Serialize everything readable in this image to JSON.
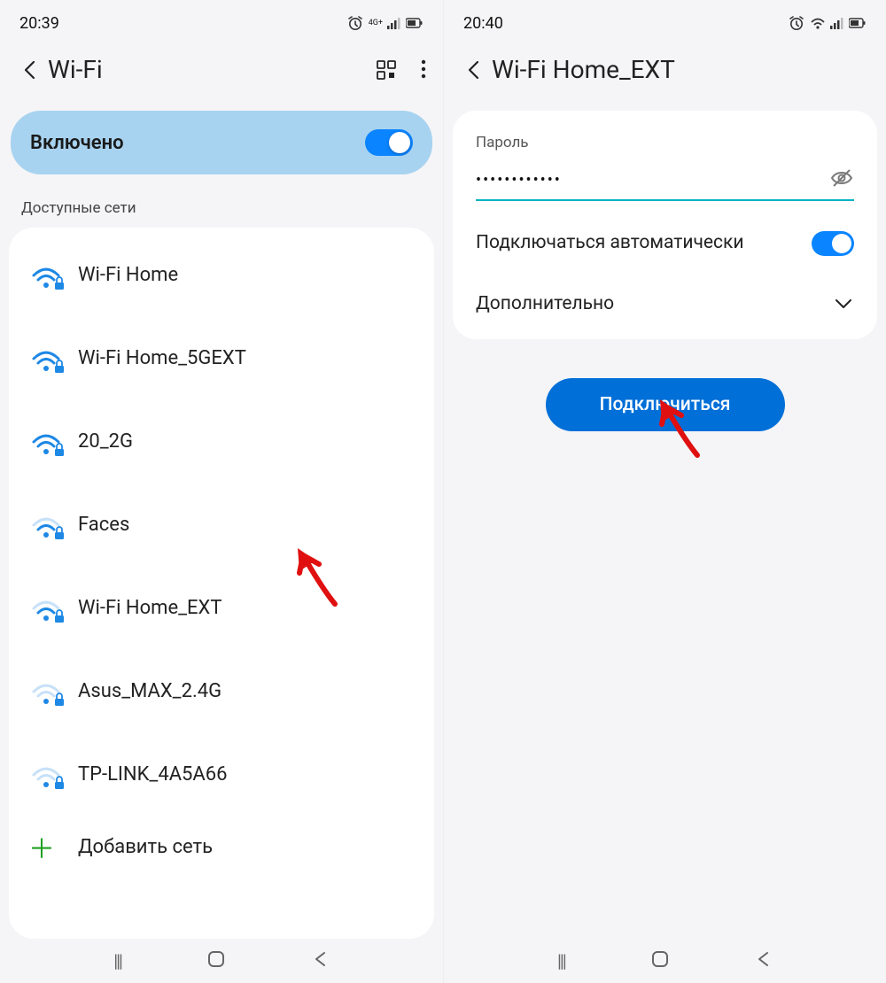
{
  "left": {
    "statusTime": "20:39",
    "headerTitle": "Wi-Fi",
    "enabledLabel": "Включено",
    "availableNetworksLabel": "Доступные сети",
    "networks": [
      {
        "name": "Wi-Fi Home",
        "secure": true,
        "strength": "strong"
      },
      {
        "name": "Wi-Fi Home_5GEXT",
        "secure": true,
        "strength": "strong"
      },
      {
        "name": "20_2G",
        "secure": true,
        "strength": "strong"
      },
      {
        "name": "Faces",
        "secure": true,
        "strength": "medium"
      },
      {
        "name": "Wi-Fi Home_EXT",
        "secure": true,
        "strength": "medium"
      },
      {
        "name": "Asus_MAX_2.4G",
        "secure": true,
        "strength": "weak"
      },
      {
        "name": "TP-LINK_4A5A66",
        "secure": true,
        "strength": "weak"
      }
    ],
    "addNetworkLabel": "Добавить сеть"
  },
  "right": {
    "statusTime": "20:40",
    "headerTitle": "Wi-Fi Home_EXT",
    "passwordLabel": "Пароль",
    "passwordValue": "••••••••••••",
    "autoConnectLabel": "Подключаться автоматически",
    "advancedLabel": "Дополнительно",
    "connectButton": "Подключиться"
  }
}
